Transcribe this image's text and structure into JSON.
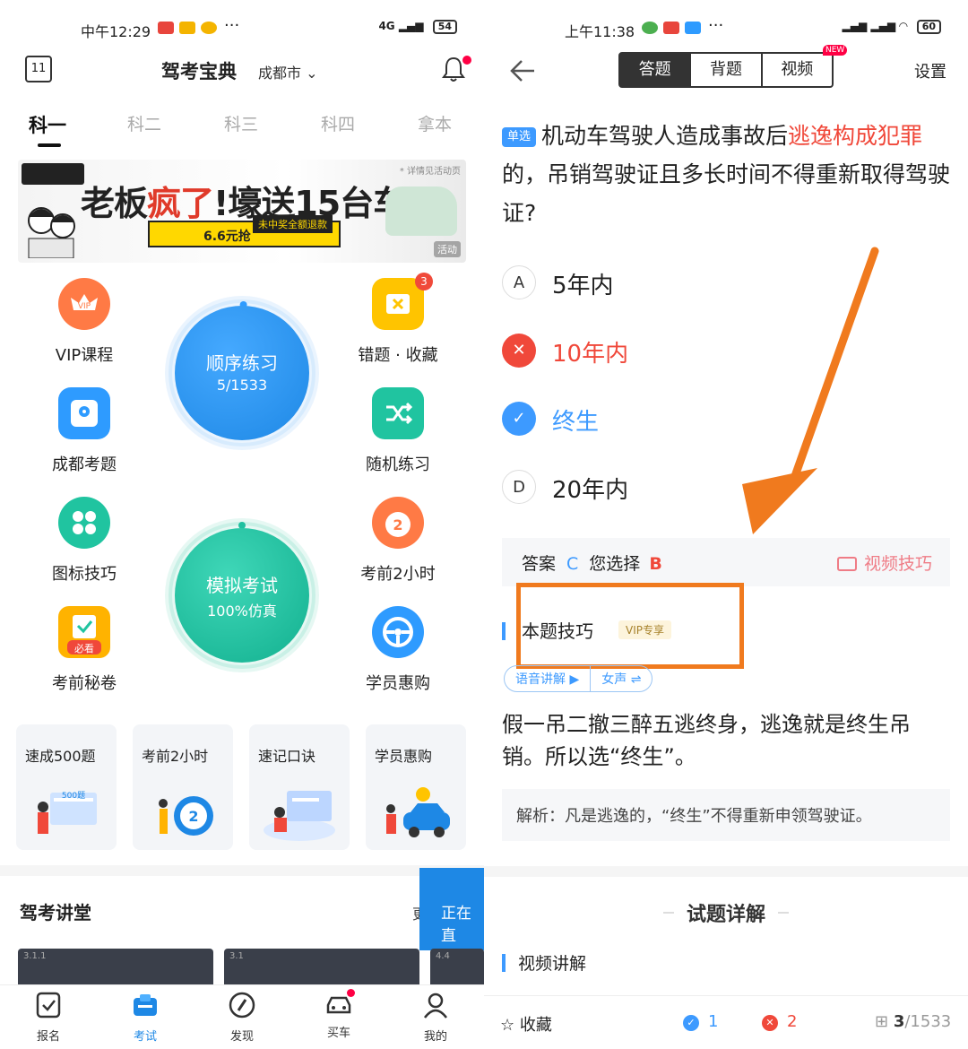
{
  "left": {
    "status": {
      "time": "中午12:29",
      "network": "4G",
      "battery": "54"
    },
    "header": {
      "calendar_day": "11",
      "title": "驾考宝典",
      "city": "成都市"
    },
    "subject_tabs": [
      "科一",
      "科二",
      "科三",
      "科四",
      "拿本"
    ],
    "banner": {
      "headline_a": "老板",
      "headline_b": "疯了",
      "headline_c": "!壕送15台车",
      "price": "6.6元抢",
      "refund": "未中奖全额退款",
      "note": "* 详情见活动页",
      "tag": "活动"
    },
    "features": {
      "vip": "VIP课程",
      "wrong": "错题 · 收藏",
      "wrong_badge": "3",
      "chengdu": "成都考题",
      "random": "随机练习",
      "icons": "图标技巧",
      "two_hours": "考前2小时",
      "secret": "考前秘卷",
      "secret_sticker": "必看",
      "shop": "学员惠购"
    },
    "order_practice": {
      "title": "顺序练习",
      "progress": "5/1533",
      "done": 5,
      "total": 1533
    },
    "mock_exam": {
      "title": "模拟考试",
      "sub": "100%仿真"
    },
    "cards": [
      "速成500题",
      "考前2小时",
      "速记口诀",
      "学员惠购"
    ],
    "card_art": {
      "card500": "500题",
      "timer": "2"
    },
    "lecture": {
      "title": "驾考讲堂",
      "more": "更",
      "floating": "正在直",
      "thumbs": [
        "3.1.1",
        "3.1",
        "4.4"
      ]
    },
    "tabbar": [
      "报名",
      "考试",
      "发现",
      "买车",
      "我的"
    ]
  },
  "right": {
    "status": {
      "time": "上午11:38",
      "battery": "60"
    },
    "header": {
      "tabs": [
        "答题",
        "背题",
        "视频"
      ],
      "new_badge": "NEW",
      "settings": "设置"
    },
    "question": {
      "tag": "单选",
      "text_a": "机动车驾驶人造成事故后",
      "text_hl": "逃逸构成犯罪",
      "text_b": "的，吊销驾驶证且多长时间不得重新取得驾驶证?"
    },
    "options": [
      {
        "key": "A",
        "text": "5年内",
        "state": "normal"
      },
      {
        "key": "B",
        "text": "10年内",
        "state": "wrong"
      },
      {
        "key": "C",
        "text": "终生",
        "state": "correct"
      },
      {
        "key": "D",
        "text": "20年内",
        "state": "normal"
      }
    ],
    "answer_bar": {
      "label_answer": "答案",
      "answer": "C",
      "label_chosen": "您选择",
      "chosen": "B",
      "video_tip": "视频技巧"
    },
    "skill": {
      "title": "本题技巧",
      "vip_tag": "VIP专享",
      "voice": "语音讲解",
      "voice_play": "▶",
      "gender": "女声",
      "gender_switch": "⇌"
    },
    "tip_text": "假一吊二撤三醉五逃终身，逃逸就是终生吊销。所以选“终生”。",
    "explain": "解析：凡是逃逸的，“终生”不得重新申领驾驶证。",
    "detail_title": "试题详解",
    "video_explain": "视频讲解",
    "bottom": {
      "favorite": "收藏",
      "correct_count": "1",
      "wrong_count": "2",
      "current": "3",
      "total": "/1533"
    }
  },
  "colors": {
    "accent_blue": "#1e88e5",
    "wrong_red": "#f0483a",
    "highlight_orange": "#f07a1e",
    "mock_green": "#20c0a0"
  }
}
